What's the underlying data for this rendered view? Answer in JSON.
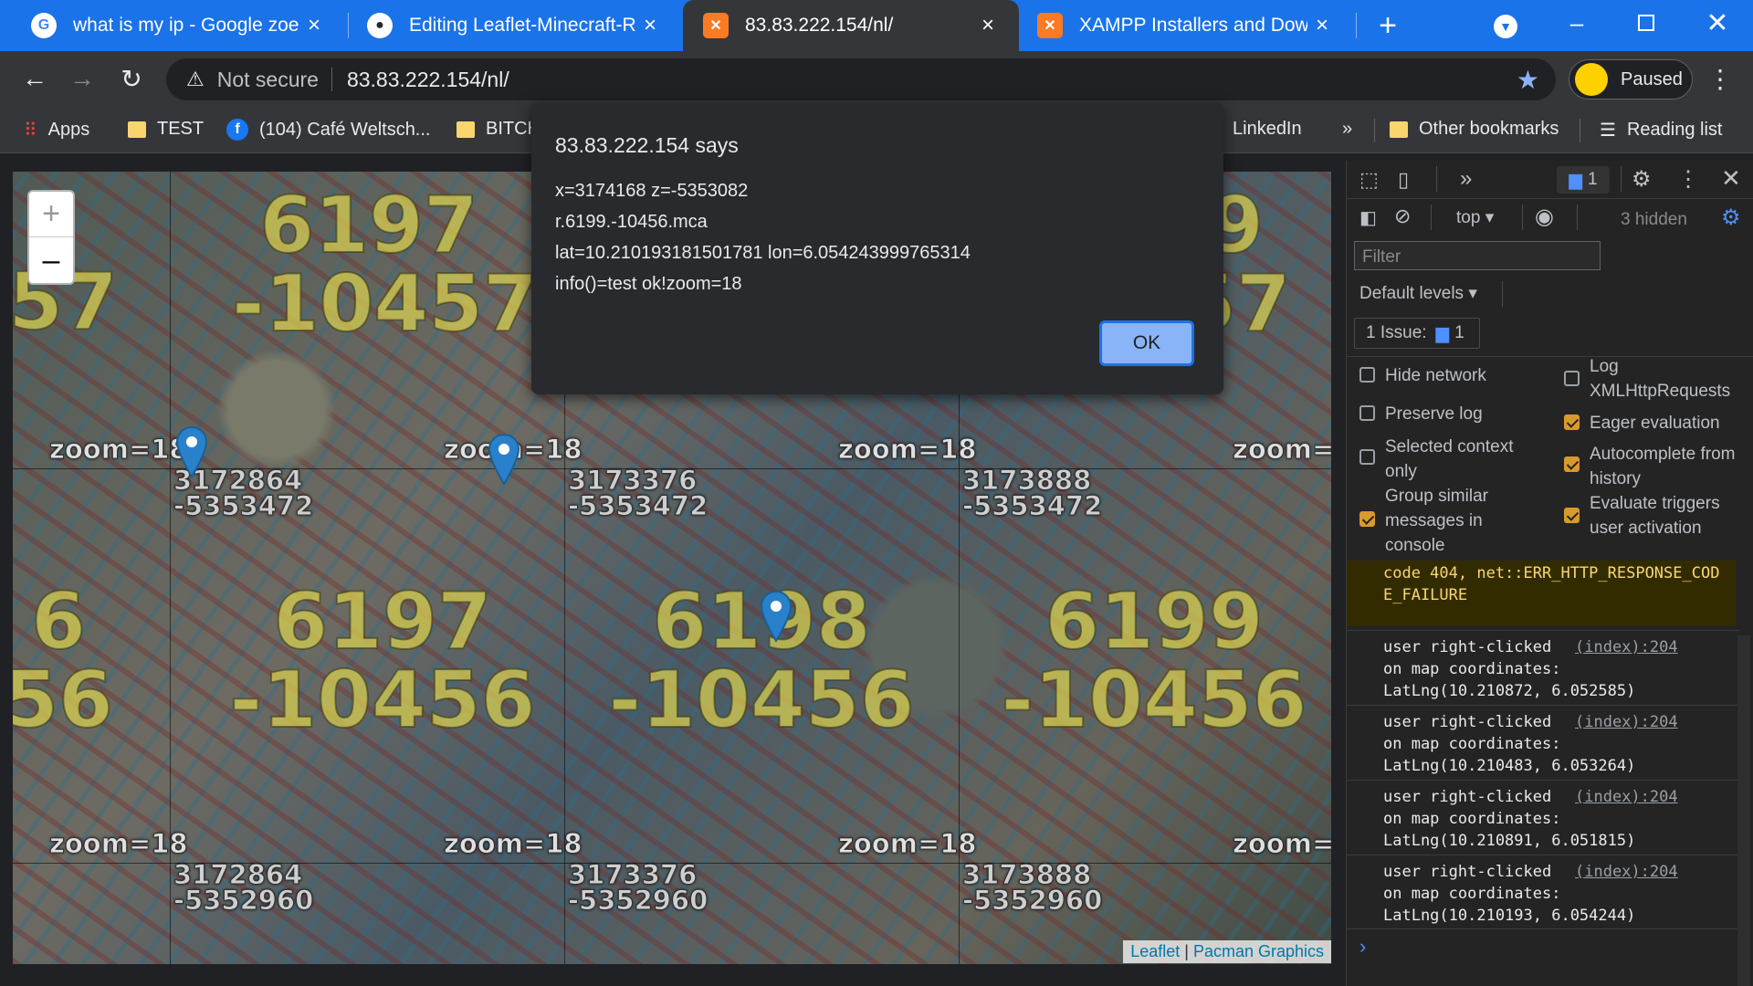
{
  "tabs": [
    {
      "title": "what is my ip - Google zoeken",
      "icon": "google-icon"
    },
    {
      "title": "Editing Leaflet-Minecraft-Regions",
      "icon": "github-icon"
    },
    {
      "title": "83.83.222.154/nl/",
      "icon": "xampp-icon",
      "active": true
    },
    {
      "title": "XAMPP Installers and Downloads",
      "icon": "xampp-icon"
    }
  ],
  "toolbar": {
    "security": "Not secure",
    "url": "83.83.222.154/nl/",
    "profile_label": "Paused"
  },
  "bookmarks": {
    "apps": "Apps",
    "items": [
      "TEST",
      "(104) Café Weltsch...",
      "BITCH",
      "LinkedIn"
    ],
    "overflow": "»",
    "other": "Other bookmarks",
    "reading": "Reading list"
  },
  "map": {
    "tiles_big": [
      {
        "a": "6197",
        "b": "-10457"
      },
      {
        "a": "6197",
        "b": "-10456"
      },
      {
        "a": "6198",
        "b": "-10456"
      },
      {
        "a": "6199",
        "b": "-10456"
      },
      {
        "a": "6",
        "b": "56"
      },
      {
        "a": "57",
        "b": ""
      },
      {
        "a": "9",
        "b": "57"
      }
    ],
    "zoom_label": "zoom=18",
    "coords": [
      {
        "x": "3172864",
        "z": "-5353472"
      },
      {
        "x": "3173376",
        "z": "-5353472"
      },
      {
        "x": "3173888",
        "z": "-5353472"
      },
      {
        "x": "3172864",
        "z": "-5352960"
      },
      {
        "x": "3173376",
        "z": "-5352960"
      },
      {
        "x": "3173888",
        "z": "-5352960"
      }
    ],
    "zoom_in": "+",
    "zoom_out": "–",
    "attribution_leaflet": "Leaflet",
    "attribution_sep": " | ",
    "attribution_source": "Pacman Graphics"
  },
  "dialog": {
    "title": "83.83.222.154 says",
    "lines": [
      "x=3174168  z=-5353082",
      "r.6199.-10456.mca",
      "lat=10.210193181501781 lon=6.054243999765314",
      "info()=test ok!zoom=18"
    ],
    "ok": "OK"
  },
  "devtools": {
    "issues_badge": "1",
    "context": "top",
    "hidden": "3 hidden",
    "filter_placeholder": "Filter",
    "levels": "Default levels",
    "issue_label": "1 Issue:",
    "issue_count": "1",
    "options_left": [
      {
        "label": "Hide network",
        "checked": false
      },
      {
        "label": "Preserve log",
        "checked": false
      },
      {
        "label": "Selected context only",
        "checked": false
      },
      {
        "label": "Group similar messages in console",
        "checked": true
      }
    ],
    "options_right": [
      {
        "label": "Log XMLHttpRequests",
        "checked": false
      },
      {
        "label": "Eager evaluation",
        "checked": true
      },
      {
        "label": "Autocomplete from history",
        "checked": true
      },
      {
        "label": "Evaluate triggers user activation",
        "checked": true
      }
    ],
    "error_text": "code 404, net::ERR_HTTP_RESPONSE_CODE_FAILURE",
    "messages": [
      {
        "text1": "user right-clicked",
        "text2": "on map coordinates:",
        "text3": "LatLng(10.210872, 6.052585)",
        "src": "(index):204"
      },
      {
        "text1": "user right-clicked",
        "text2": "on map coordinates:",
        "text3": "LatLng(10.210483, 6.053264)",
        "src": "(index):204"
      },
      {
        "text1": "user right-clicked",
        "text2": "on map coordinates:",
        "text3": "LatLng(10.210891, 6.051815)",
        "src": "(index):204"
      },
      {
        "text1": "user right-clicked",
        "text2": "on map coordinates:",
        "text3": "LatLng(10.210193, 6.054244)",
        "src": "(index):204"
      }
    ],
    "prompt": "›"
  },
  "colors": {
    "tabstrip": "#1a73e8",
    "star": "#8ab4f8",
    "marker": "#2a81cb"
  }
}
